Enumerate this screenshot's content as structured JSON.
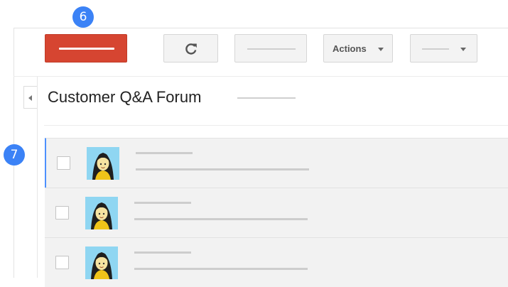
{
  "badges": {
    "step_six": "6",
    "step_seven": "7"
  },
  "toolbar": {
    "actions_label": "Actions",
    "refresh_icon": "refresh-icon",
    "compose_color": "#d64531"
  },
  "forum": {
    "title": "Customer Q&A Forum"
  },
  "threads": [
    {
      "selected": true,
      "checked": false
    },
    {
      "selected": false,
      "checked": false
    },
    {
      "selected": false,
      "checked": false
    }
  ],
  "colors": {
    "badge": "#3b82f6",
    "selection_accent": "#4d90fe",
    "row_bg": "#f2f2f2",
    "avatar_bg": "#8fd6f2"
  }
}
